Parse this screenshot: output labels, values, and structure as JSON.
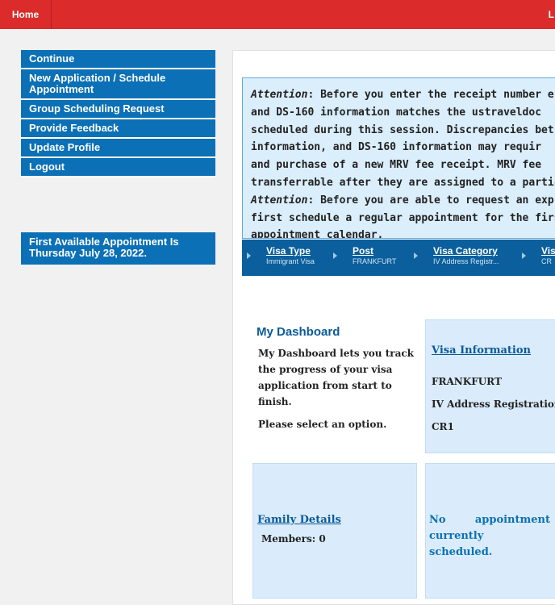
{
  "topbar": {
    "home": "Home",
    "right_partial": "L"
  },
  "sidebar": {
    "items": [
      {
        "label": "Continue"
      },
      {
        "label": "New Application / Schedule Appointment"
      },
      {
        "label": "Group Scheduling Request"
      },
      {
        "label": "Provide Feedback"
      },
      {
        "label": "Update Profile"
      },
      {
        "label": "Logout"
      }
    ],
    "notice": "First Available Appointment Is Thursday July 28, 2022."
  },
  "attention": {
    "line1_em": "Attention",
    "line1": ": Before you enter the receipt number e",
    "line2": "and DS-160 information matches the ustraveldoc",
    "line3": "scheduled during this session. Discrepancies bet",
    "line4": "information, and DS-160 information may requir",
    "line5": "and purchase of a new MRV fee receipt. MRV fee",
    "line6": "transferrable after they are assigned to a particu",
    "line7_em": "Attention",
    "line7": ": Before you are able to request an exp",
    "line8": "first schedule a regular appointment for the first",
    "line9": "appointment calendar."
  },
  "steps": [
    {
      "title": "Visa Type",
      "value": "Immigrant Visa"
    },
    {
      "title": "Post",
      "value": "FRANKFURT"
    },
    {
      "title": "Visa Category",
      "value": "IV Address Registr..."
    },
    {
      "title": "Vis",
      "value": "CR"
    }
  ],
  "dashboard": {
    "title": "My Dashboard",
    "description": "My Dashboard lets you track the progress of your visa application from start to finish.",
    "prompt": "Please select an option."
  },
  "visa_info": {
    "link": "Visa Information",
    "post": "FRANKFURT",
    "category": "IV Address Registration",
    "class": "CR1"
  },
  "family": {
    "link": "Family Details",
    "members": "Members: 0"
  },
  "appointment": {
    "status": "No appointment currently scheduled."
  }
}
